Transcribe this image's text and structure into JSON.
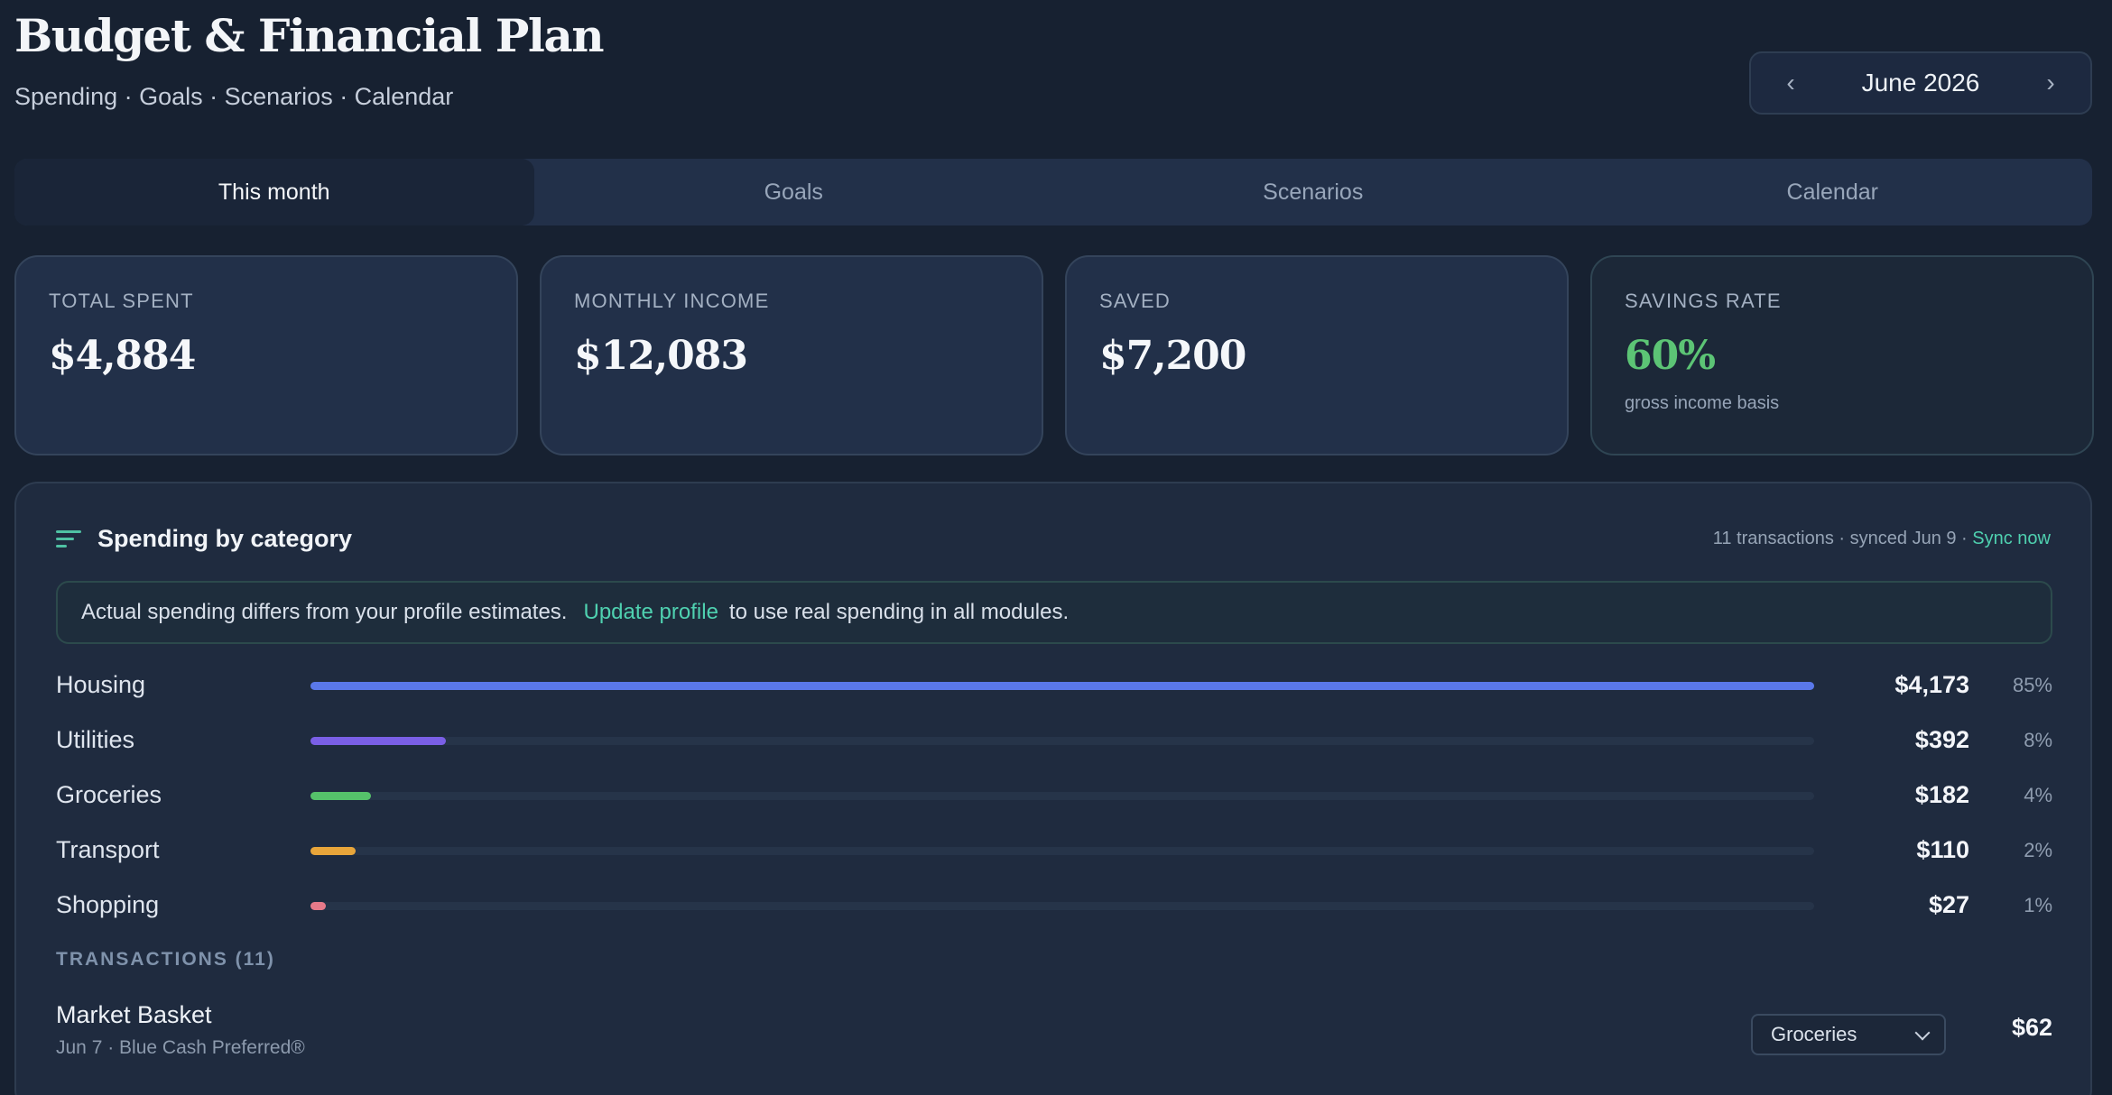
{
  "header": {
    "title": "Budget & Financial Plan",
    "subtitle": "Spending · Goals · Scenarios · Calendar",
    "month": "June 2026",
    "prev_glyph": "‹",
    "next_glyph": "›"
  },
  "tabs": [
    {
      "label": "This month",
      "active": true
    },
    {
      "label": "Goals",
      "active": false
    },
    {
      "label": "Scenarios",
      "active": false
    },
    {
      "label": "Calendar",
      "active": false
    }
  ],
  "stats": {
    "total_spent": {
      "label": "TOTAL SPENT",
      "value": "$4,884"
    },
    "monthly_income": {
      "label": "MONTHLY INCOME",
      "value": "$12,083"
    },
    "saved": {
      "label": "SAVED",
      "value": "$7,200"
    },
    "savings_rate": {
      "label": "SAVINGS RATE",
      "value": "60%",
      "note": "gross income basis",
      "color": "#5cc475"
    }
  },
  "spending": {
    "title": "Spending by category",
    "meta": "11 transactions · synced Jun 9 · ",
    "sync_label": "Sync now",
    "notice": {
      "text_before": "Actual spending differs from your profile estimates.",
      "link": "Update profile",
      "text_after": "to use real spending in all modules."
    },
    "categories": [
      {
        "name": "Housing",
        "amount": "$4,173",
        "pct": "85%",
        "share": 1.0,
        "color": "#5a78ea"
      },
      {
        "name": "Utilities",
        "amount": "$392",
        "pct": "8%",
        "share": 0.09,
        "color": "#7a5fe6"
      },
      {
        "name": "Groceries",
        "amount": "$182",
        "pct": "4%",
        "share": 0.04,
        "color": "#55c26a"
      },
      {
        "name": "Transport",
        "amount": "$110",
        "pct": "2%",
        "share": 0.03,
        "color": "#e8a53a"
      },
      {
        "name": "Shopping",
        "amount": "$27",
        "pct": "1%",
        "share": 0.01,
        "color": "#e77a8a"
      }
    ],
    "transactions_heading": "TRANSACTIONS (11)",
    "transactions": [
      {
        "merchant": "Market Basket",
        "detail": "Jun 7 · Blue Cash Preferred®",
        "category": "Groceries",
        "amount": "$62"
      }
    ]
  }
}
